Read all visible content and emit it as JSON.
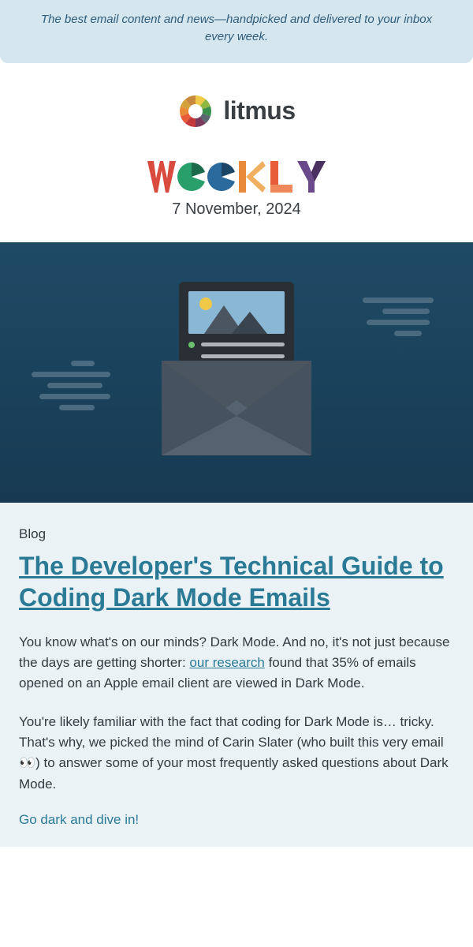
{
  "tagline": "The best email content and news—handpicked and delivered to your inbox every week.",
  "brand": "litmus",
  "date": "7 November, 2024",
  "article": {
    "category": "Blog",
    "title": "The Developer's Technical Guide to Coding Dark Mode Emails",
    "p1_a": "You know what's on our minds? Dark Mode. And no, it's not just because the days are getting shorter: ",
    "p1_link": "our research",
    "p1_b": " found that 35% of emails opened on an Apple email client are viewed in Dark Mode.",
    "p2": "You're likely familiar with the fact that coding for Dark Mode is… tricky. That's why, we picked the mind of Carin Slater (who built this very email 👀) to answer some of your most frequently asked questions about Dark Mode.",
    "cta": "Go dark and dive in!"
  }
}
